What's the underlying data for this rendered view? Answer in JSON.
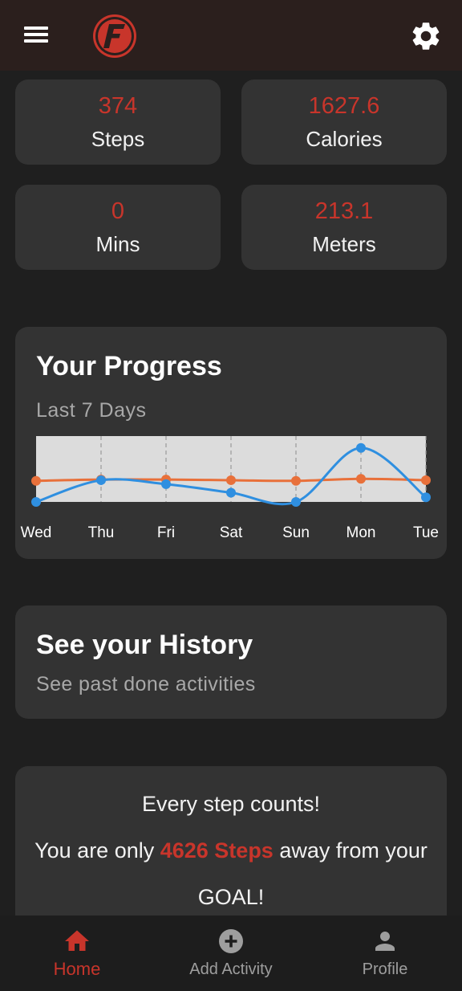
{
  "stats": [
    {
      "value": "374",
      "label": "Steps"
    },
    {
      "value": "1627.6",
      "label": "Calories"
    },
    {
      "value": "0",
      "label": "Mins"
    },
    {
      "value": "213.1",
      "label": "Meters"
    }
  ],
  "progress": {
    "title": "Your Progress",
    "subtitle": "Last 7 Days"
  },
  "chart_data": {
    "type": "line",
    "categories": [
      "Wed",
      "Thu",
      "Fri",
      "Sat",
      "Sun",
      "Mon",
      "Tue"
    ],
    "series": [
      {
        "color": "#e8703a",
        "values": [
          0.32,
          0.34,
          0.34,
          0.33,
          0.32,
          0.35,
          0.33
        ]
      },
      {
        "color": "#2f8fe0",
        "values": [
          0.0,
          0.33,
          0.27,
          0.14,
          0.0,
          0.82,
          0.07
        ]
      }
    ],
    "ylim": [
      0,
      1
    ],
    "grid": "vertical-dashed",
    "background": "#dcdcdc"
  },
  "history": {
    "title": "See your History",
    "subtitle": "See past done activities"
  },
  "goal": {
    "line1": "Every step counts!",
    "line2_prefix": "You are only ",
    "line2_highlight": "4626 Steps",
    "line2_suffix": " away from your",
    "line3": "GOAL!"
  },
  "nav": {
    "home": "Home",
    "add": "Add Activity",
    "profile": "Profile"
  },
  "colors": {
    "accent": "#c8352b",
    "card": "#333333",
    "appbar": "#2b1f1d"
  }
}
